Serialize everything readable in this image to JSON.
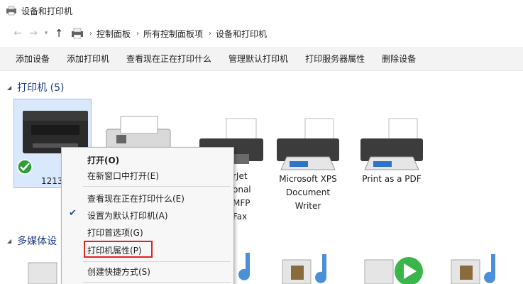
{
  "window": {
    "title": "设备和打印机",
    "icon": "devices-printers-icon"
  },
  "address": {
    "back_icon": "back-arrow-icon",
    "forward_icon": "forward-arrow-icon",
    "history_icon": "chevron-down-icon",
    "up_icon": "up-arrow-icon",
    "breadcrumb": [
      "控制面板",
      "所有控制面板项",
      "设备和打印机"
    ]
  },
  "commands": [
    "添加设备",
    "添加打印机",
    "查看现在正在打印什么",
    "管理默认打印机",
    "打印服务器属性",
    "删除设备"
  ],
  "groups": {
    "printers": {
      "title": "打印机 (5)"
    },
    "multimedia": {
      "title": "多媒体设"
    }
  },
  "printers": [
    {
      "label": "1213",
      "icon": "mfp-printer-icon",
      "status": "default-check-icon"
    },
    {
      "label": "",
      "icon": "fax-icon"
    },
    {
      "label_lines": [
        "rJet",
        "onal",
        "MFP",
        "Fax"
      ],
      "icon": "laserjet-fax-printer-icon"
    },
    {
      "label": "Microsoft XPS Document Writer",
      "label_lines": [
        "Microsoft XPS",
        "Document",
        "Writer"
      ],
      "icon": "xps-printer-icon"
    },
    {
      "label": "Print as a PDF",
      "icon": "pdf-printer-icon"
    }
  ],
  "context_menu": {
    "items": [
      {
        "label": "打开(O)",
        "bold": true
      },
      {
        "label": "在新窗口中打开(E)"
      },
      {
        "label": "查看现在正在打印什么(E)"
      },
      {
        "label": "设置为默认打印机(A)",
        "checked": true
      },
      {
        "label": "打印首选项(G)"
      },
      {
        "label": "打印机属性(P)",
        "highlighted": true
      },
      {
        "label": "创建快捷方式(S)"
      }
    ]
  },
  "colors": {
    "accent": "#1e3a87",
    "highlight_box": "#e02424",
    "selection": "#d9e8fb"
  }
}
